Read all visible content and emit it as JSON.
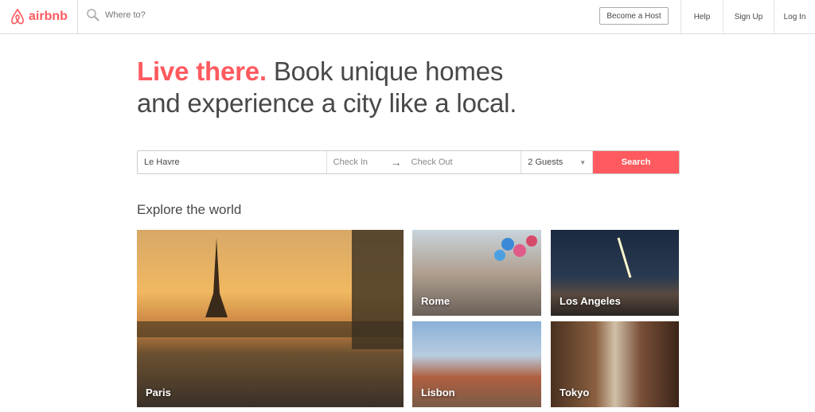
{
  "header": {
    "logo_text": "airbnb",
    "search_placeholder": "Where to?",
    "become_host": "Become a Host",
    "help": "Help",
    "sign_up": "Sign Up",
    "log_in": "Log In",
    "brand_color": "#ff5a5f"
  },
  "hero": {
    "highlight": "Live there.",
    "line1_rest": " Book unique homes",
    "line2": "and experience a city like a local."
  },
  "search": {
    "location_value": "Le Havre",
    "check_in_placeholder": "Check In",
    "check_out_placeholder": "Check Out",
    "guests": "2 Guests",
    "button": "Search"
  },
  "explore": {
    "title": "Explore the world",
    "cities": [
      {
        "name": "Paris"
      },
      {
        "name": "Rome"
      },
      {
        "name": "Los Angeles"
      },
      {
        "name": "Lisbon"
      },
      {
        "name": "Tokyo"
      }
    ]
  }
}
